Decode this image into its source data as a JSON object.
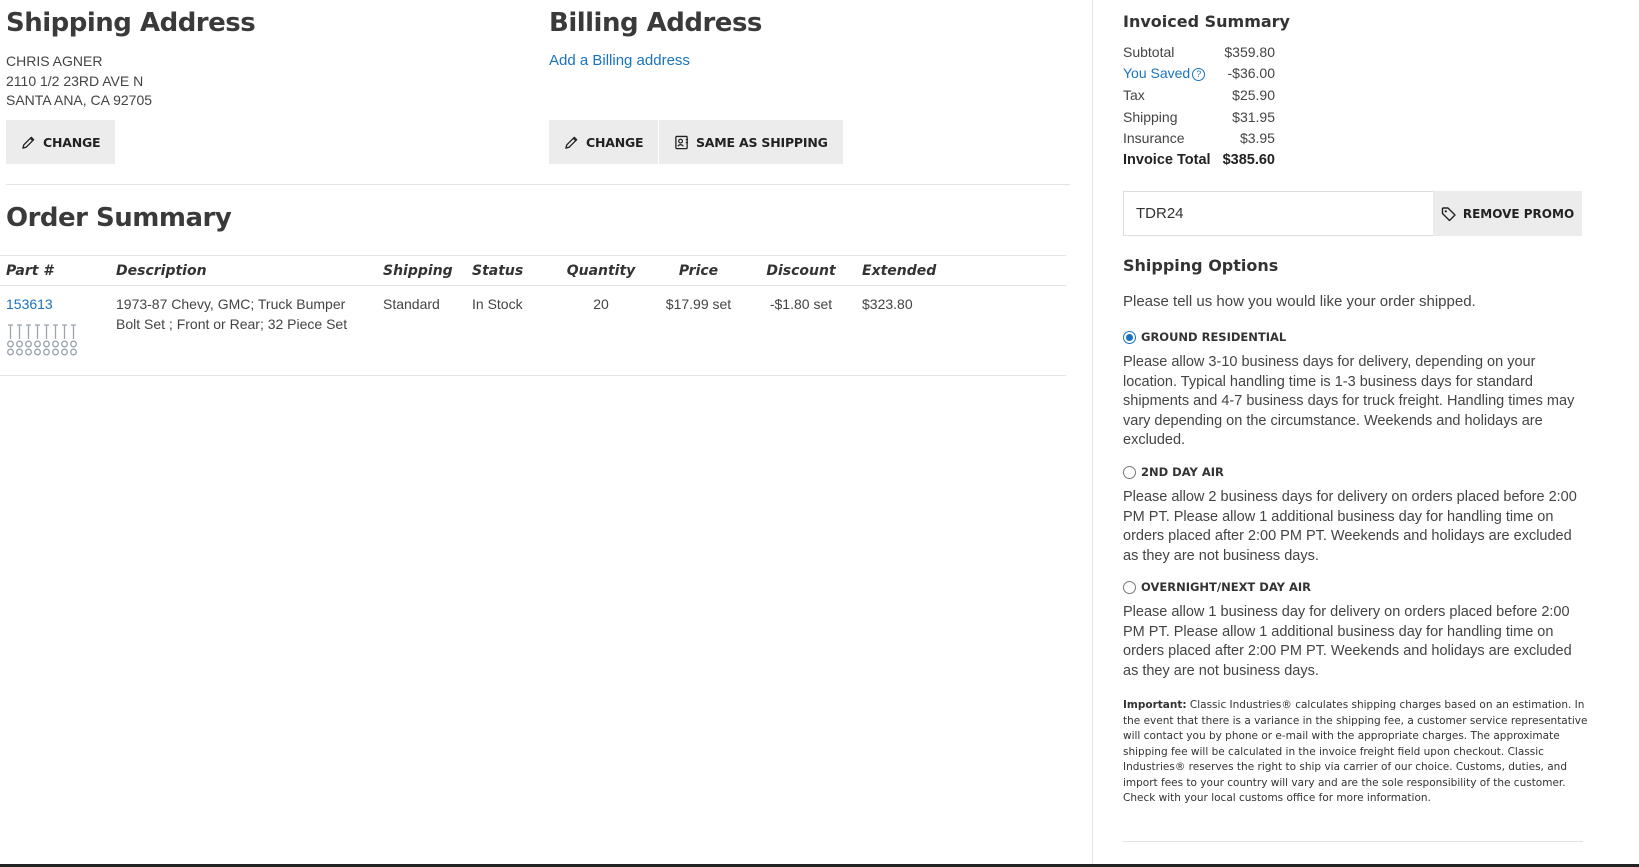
{
  "shipping": {
    "title": "Shipping Address",
    "name": "CHRIS AGNER",
    "street": "2110 1/2 23RD AVE N",
    "city": "SANTA ANA, CA 92705",
    "change_label": "CHANGE"
  },
  "billing": {
    "title": "Billing Address",
    "add_link": "Add a Billing address",
    "change_label": "CHANGE",
    "same_label": "SAME AS SHIPPING"
  },
  "order": {
    "title": "Order Summary",
    "columns": [
      "Part #",
      "Description",
      "Shipping",
      "Status",
      "Quantity",
      "Price",
      "Discount",
      "Extended"
    ],
    "items": [
      {
        "part": "153613",
        "description": "1973-87 Chevy, GMC; Truck Bumper Bolt Set ; Front or Rear; 32 Piece Set",
        "shipping": "Standard",
        "status": "In Stock",
        "quantity": "20",
        "price": "$17.99 set",
        "discount": "-$1.80 set",
        "extended": "$323.80"
      }
    ]
  },
  "invoice": {
    "title": "Invoiced Summary",
    "rows": [
      {
        "label": "Subtotal",
        "value": "$359.80"
      },
      {
        "label": "You Saved",
        "value": "-$36.00"
      },
      {
        "label": "Tax",
        "value": "$25.90"
      },
      {
        "label": "Shipping",
        "value": "$31.95"
      },
      {
        "label": "Insurance",
        "value": "$3.95"
      },
      {
        "label": "Invoice Total",
        "value": "$385.60"
      }
    ]
  },
  "promo": {
    "value": "TDR24",
    "remove_label": "REMOVE PROMO"
  },
  "shipping_options": {
    "title": "Shipping Options",
    "intro": "Please tell us how you would like your order shipped.",
    "options": [
      {
        "label": "GROUND RESIDENTIAL",
        "selected": true,
        "desc": "Please allow 3-10 business days for delivery, depending on your location. Typical handling time is 1-3 business days for standard shipments and 4-7 business days for truck freight. Handling times may vary depending on the circumstance. Weekends and holidays are excluded."
      },
      {
        "label": "2ND DAY AIR",
        "selected": false,
        "desc": "Please allow 2 business days for delivery on orders placed before 2:00 PM PT. Please allow 1 additional business day for handling time on orders placed after 2:00 PM PT. Weekends and holidays are excluded as they are not business days."
      },
      {
        "label": "OVERNIGHT/NEXT DAY AIR",
        "selected": false,
        "desc": "Please allow 1 business day for delivery on orders placed before 2:00 PM PT. Please allow 1 additional business day for handling time on orders placed after 2:00 PM PT. Weekends and holidays are excluded as they are not business days."
      }
    ],
    "important_label": "Important:",
    "important_text": "Classic Industries® calculates shipping charges based on an estimation. In the event that there is a variance in the shipping fee, a customer service representative will contact you by phone or e-mail with the appropriate charges. The approximate shipping fee will be calculated in the invoice freight field upon checkout. Classic Industries® reserves the right to ship via carrier of our choice. Customs, duties, and import fees to your country will vary and are the sole responsibility of the customer. Check with your local customs office for more information."
  },
  "colors": {
    "link": "#1a73c0",
    "button_bg": "#ececec",
    "heading": "#3a3a3a"
  }
}
